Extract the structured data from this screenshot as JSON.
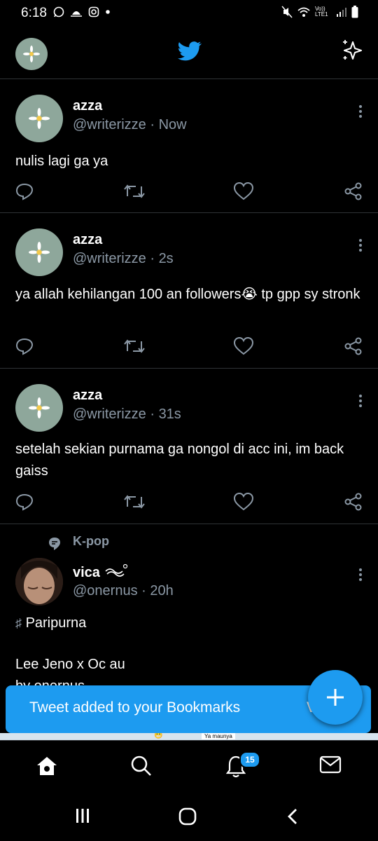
{
  "status": {
    "time": "6:18",
    "network": "Vo)) LTE1"
  },
  "header": {
    "logo": "twitter-bird-icon",
    "action_icon": "sparkle-icon"
  },
  "tweets": [
    {
      "name": "azza",
      "handle": "@writerizze",
      "time": "Now",
      "text": "nulis lagi ga ya"
    },
    {
      "name": "azza",
      "handle": "@writerizze",
      "time": "2s",
      "text": "ya allah kehilangan 100 an followers😭 tp gpp sy stronk"
    },
    {
      "name": "azza",
      "handle": "@writerizze",
      "time": "31s",
      "text": "setelah sekian purnama ga nongol di acc ini, im back gaiss"
    },
    {
      "topic": "K-pop",
      "name": "vica",
      "handle": "@onernus",
      "time": "20h",
      "line1": "Paripurna",
      "line2": "Lee Jeno x Oc au",
      "line3": "by onernus"
    }
  ],
  "separator": "·",
  "toast": {
    "message": "Tweet added to your Bookmarks",
    "action": "V"
  },
  "nav": {
    "notifications_badge": "15"
  },
  "colors": {
    "accent": "#1d9bf0",
    "muted": "#8b98a5",
    "divider": "#2f3336",
    "avatar_bg": "#8ea79b"
  }
}
